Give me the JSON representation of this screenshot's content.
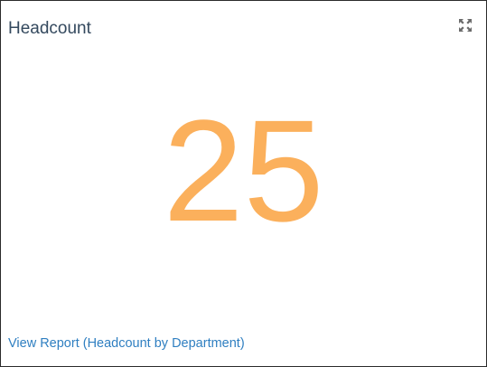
{
  "widget": {
    "title": "Headcount",
    "value": "25",
    "link_label": "View Report (Headcount by Department)",
    "expand_icon": "expand-arrows-icon"
  },
  "colors": {
    "title": "#34495e",
    "value": "#fbb05c",
    "link": "#2f7fc1",
    "border": "#2b2b2b"
  }
}
